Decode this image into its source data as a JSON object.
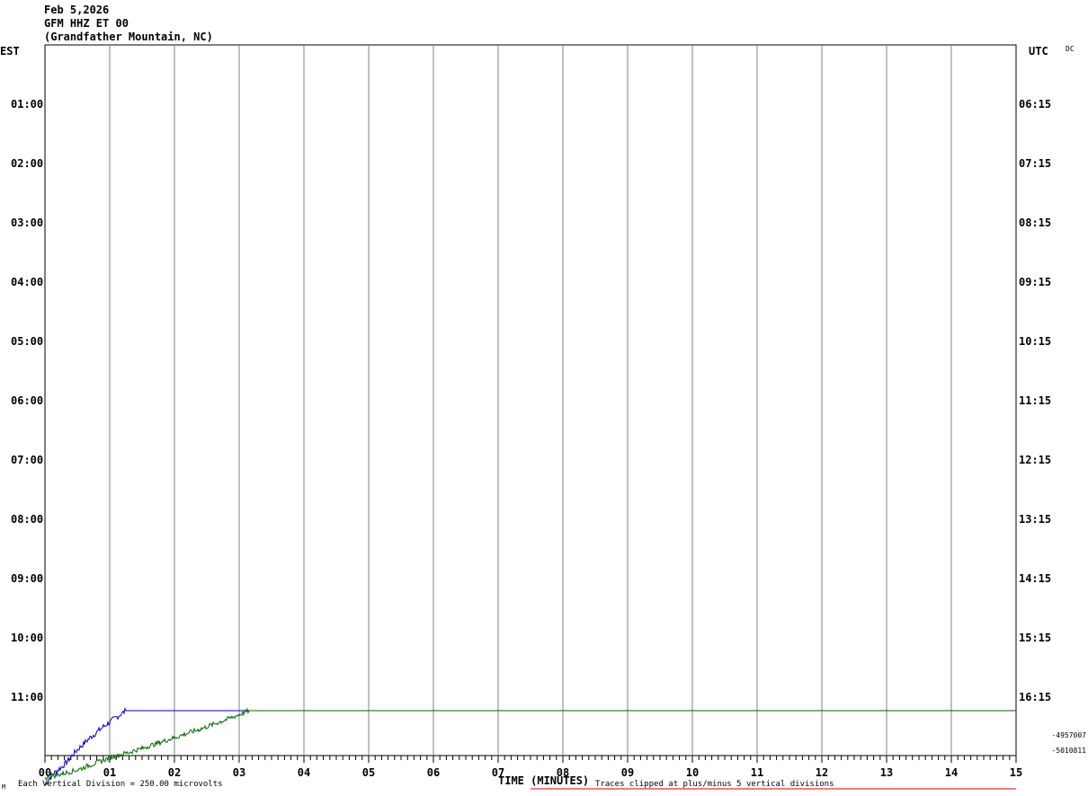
{
  "header": {
    "date": "Feb 5,2026",
    "station": "GFM HHZ ET 00",
    "location": "(Grandfather Mountain, NC)"
  },
  "footer": {
    "corner_mark": "M",
    "division_note": "Each Vertical Division =  250.00 microvolts",
    "clip_note": "Traces clipped at plus/minus 5 vertical divisions"
  },
  "colors": {
    "background": "#ffffff",
    "grid": "#808080",
    "axis": "#000000",
    "trace_blue": "#0000cc",
    "trace_green": "#006600",
    "clip_line": "#cc0000"
  },
  "chart_data": {
    "type": "line",
    "title": "",
    "xlabel": "TIME (MINUTES)",
    "xlim": [
      0,
      15
    ],
    "x_ticks": [
      "00",
      "01",
      "02",
      "03",
      "04",
      "05",
      "06",
      "07",
      "08",
      "09",
      "10",
      "11",
      "12",
      "13",
      "14",
      "15"
    ],
    "left_axis_label": "EST",
    "right_axis_label": "UTC",
    "right_corner_label": "DC",
    "row_labels_left": [
      "01:00",
      "02:00",
      "03:00",
      "04:00",
      "05:00",
      "06:00",
      "07:00",
      "08:00",
      "09:00",
      "10:00",
      "11:00"
    ],
    "row_labels_right": [
      "06:15",
      "07:15",
      "08:15",
      "09:15",
      "10:15",
      "11:15",
      "12:15",
      "13:15",
      "14:15",
      "15:15",
      "16:15"
    ],
    "row_count": 12,
    "dc_offsets": [
      "-4957007",
      "-5010811"
    ],
    "vertical_grid": true,
    "series": [
      {
        "color": "#0000cc",
        "points": [
          [
            0,
            -5.5
          ],
          [
            0.1,
            -4.8
          ],
          [
            0.3,
            -4.0
          ],
          [
            0.5,
            -2.9
          ],
          [
            0.7,
            -2.0
          ],
          [
            0.9,
            -1.2
          ],
          [
            1.1,
            -0.5
          ],
          [
            1.25,
            0.0
          ],
          [
            15,
            0.0
          ]
        ]
      },
      {
        "color": "#006600",
        "points": [
          [
            0,
            -5.0
          ],
          [
            0.5,
            -4.4
          ],
          [
            1.0,
            -3.5
          ],
          [
            1.5,
            -2.8
          ],
          [
            2.0,
            -2.0
          ],
          [
            2.5,
            -1.2
          ],
          [
            3.0,
            -0.3
          ],
          [
            3.15,
            0.0
          ],
          [
            15,
            0.0
          ]
        ]
      }
    ]
  }
}
